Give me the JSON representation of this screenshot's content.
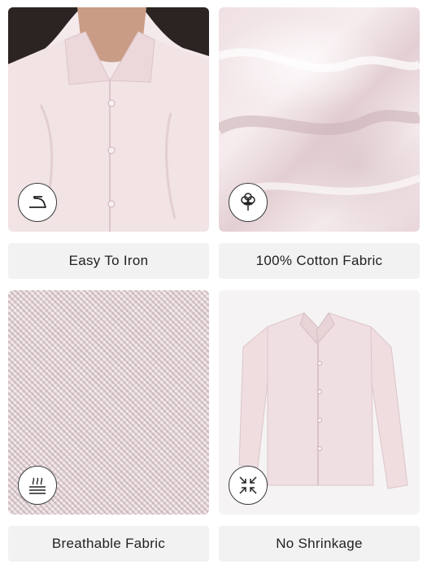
{
  "features": [
    {
      "label": "Easy To Iron",
      "icon": "iron-icon"
    },
    {
      "label": "100% Cotton Fabric",
      "icon": "cotton-flower-icon"
    },
    {
      "label": "Breathable Fabric",
      "icon": "breathable-fabric-icon"
    },
    {
      "label": "No Shrinkage",
      "icon": "no-shrink-arrows-icon"
    }
  ],
  "colors": {
    "shirt_pink": "#f0dfe2",
    "label_bg": "#f2f2f2",
    "text": "#222222"
  }
}
